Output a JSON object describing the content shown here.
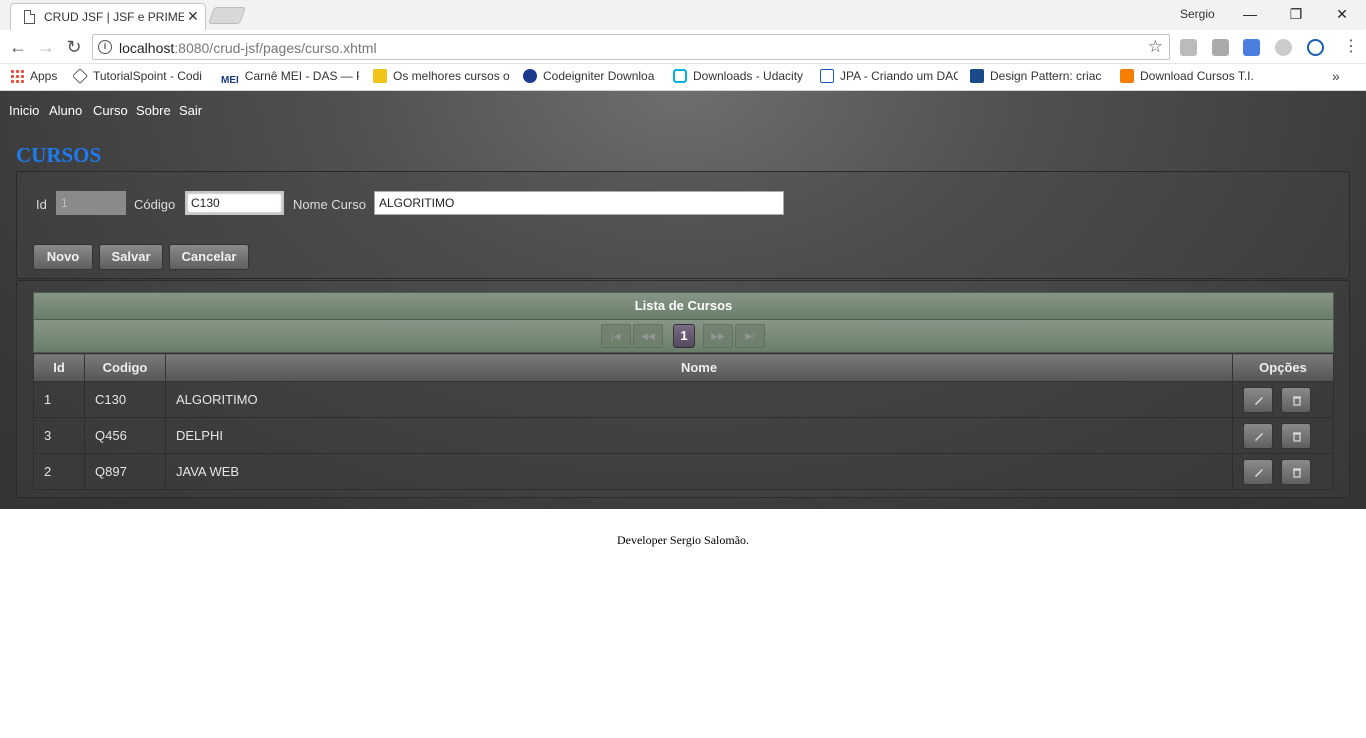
{
  "browser": {
    "tab_title": "CRUD JSF | JSF e PRIMEFACES",
    "user": "Sergio",
    "url_host": "localhost",
    "url_rest": ":8080/crud-jsf/pages/curso.xhtml",
    "bookmarks": [
      "Apps",
      "TutorialSpoint - Codi",
      "Carnê MEI - DAS — P",
      "Os melhores cursos o",
      "Codeigniter Downloa",
      "Downloads - Udacity",
      "JPA - Criando um DAO",
      "Design Pattern: criac",
      "Download Cursos T.I."
    ],
    "bookmark_more": "»"
  },
  "menu": [
    "Inicio",
    "Aluno",
    "Curso",
    "Sobre",
    "Sair"
  ],
  "page_title": "CURSOS",
  "form": {
    "id_label": "Id",
    "id_value": "1",
    "codigo_label": "Código",
    "codigo_value": "C130",
    "nome_label": "Nome Curso",
    "nome_value": "ALGORITIMO",
    "btn_novo": "Novo",
    "btn_salvar": "Salvar",
    "btn_cancelar": "Cancelar"
  },
  "table": {
    "header": "Lista de Cursos",
    "current_page": "1",
    "columns": [
      "Id",
      "Codigo",
      "Nome",
      "Opções"
    ],
    "rows": [
      {
        "id": "1",
        "codigo": "C130",
        "nome": "ALGORITIMO"
      },
      {
        "id": "3",
        "codigo": "Q456",
        "nome": "DELPHI"
      },
      {
        "id": "2",
        "codigo": "Q897",
        "nome": "JAVA WEB"
      }
    ]
  },
  "footer": "Developer Sergio Salomão."
}
